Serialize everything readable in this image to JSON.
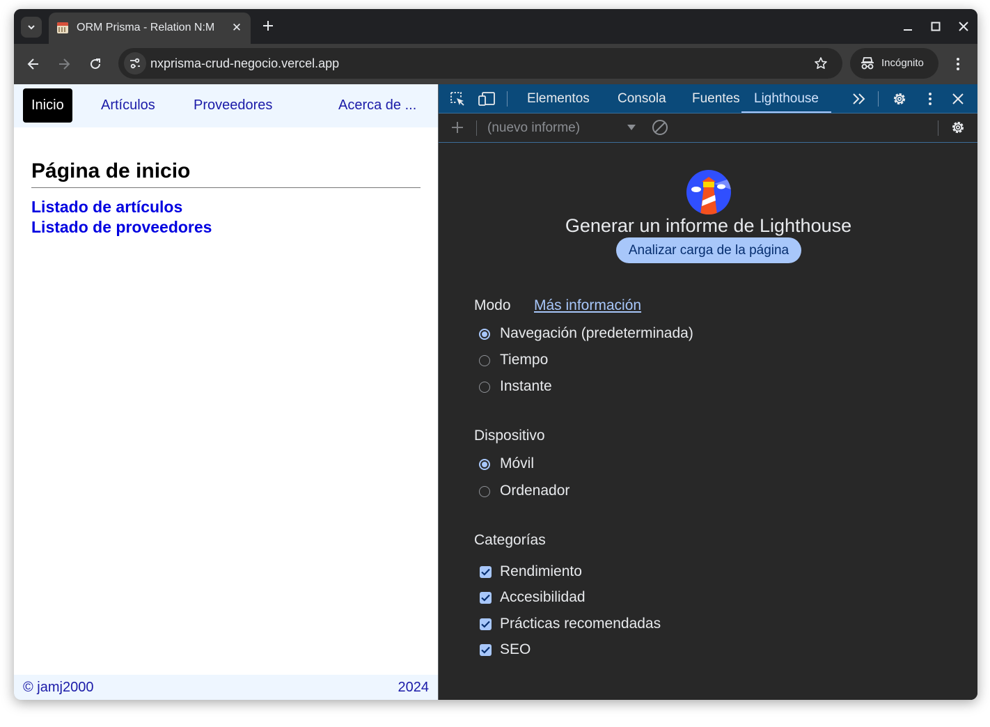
{
  "browser": {
    "tab_title": "ORM Prisma - Relation N:M",
    "url": "nxprisma-crud-negocio.vercel.app",
    "profile_label": "Incógnito"
  },
  "site": {
    "nav": [
      "Inicio",
      "Artículos",
      "Proveedores",
      "Acerca de ..."
    ],
    "heading": "Página de inicio",
    "links": [
      "Listado de artículos",
      "Listado de proveedores"
    ],
    "footer_left": "© jamj2000",
    "footer_right": "2024"
  },
  "devtools": {
    "tabs": [
      "Elementos",
      "Consola",
      "Fuentes",
      "Lighthouse"
    ],
    "selected_tab": "Lighthouse",
    "report_select": "(nuevo informe)",
    "title": "Generar un informe de Lighthouse",
    "analyze_button": "Analizar carga de la página",
    "mode": {
      "label": "Modo",
      "more_info": "Más información",
      "options": [
        "Navegación (predeterminada)",
        "Tiempo",
        "Instante"
      ],
      "selected": "Navegación (predeterminada)"
    },
    "device": {
      "label": "Dispositivo",
      "options": [
        "Móvil",
        "Ordenador"
      ],
      "selected": "Móvil"
    },
    "categories": {
      "label": "Categorías",
      "options": [
        "Rendimiento",
        "Accesibilidad",
        "Prácticas recomendadas",
        "SEO"
      ],
      "checked": [
        true,
        true,
        true,
        true
      ]
    }
  },
  "colors": {
    "devtools_tab_bar": "#0b4a7a",
    "accent": "#a8c7fa",
    "page_link": "#0000e0",
    "page_nav": "#1b1ba8"
  },
  "icons": [
    "tab-search-chevron-icon",
    "favicon",
    "close-icon",
    "plus-icon",
    "minimize-icon",
    "maximize-icon",
    "back-icon",
    "forward-icon",
    "reload-icon",
    "site-info-icon",
    "star-icon",
    "incognito-icon",
    "kebab-icon",
    "inspect-icon",
    "device-toggle-icon",
    "more-tabs-icon",
    "gear-icon",
    "clear-icon",
    "lighthouse-logo"
  ]
}
